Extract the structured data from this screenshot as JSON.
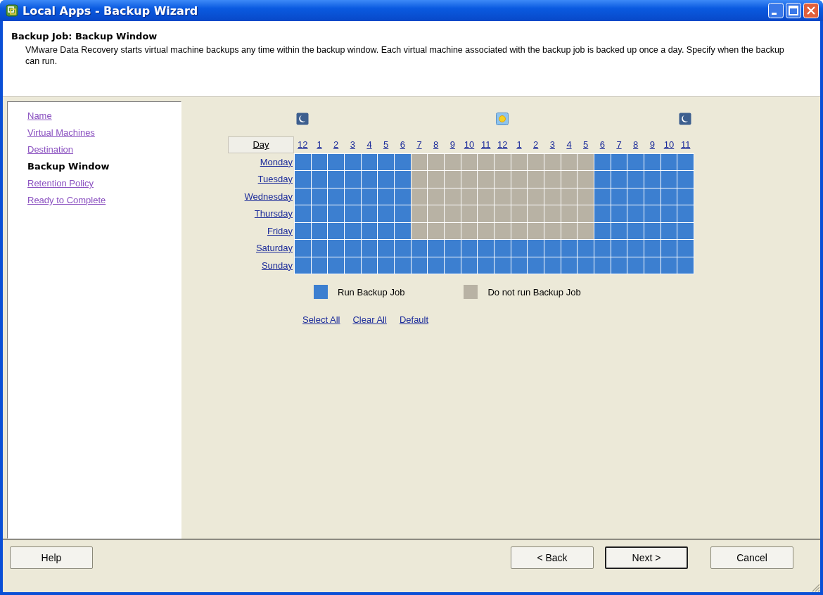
{
  "window": {
    "title": "Local Apps - Backup Wizard"
  },
  "header": {
    "title": "Backup Job: Backup Window",
    "description": "VMware Data Recovery starts virtual machine backups any time within the backup window.  Each virtual machine associated with the backup job is backed up once a day.  Specify when the backup can run."
  },
  "steps": [
    {
      "label": "Name",
      "selected": false
    },
    {
      "label": "Virtual Machines",
      "selected": false
    },
    {
      "label": "Destination",
      "selected": false
    },
    {
      "label": "Backup Window",
      "selected": true
    },
    {
      "label": "Retention Policy",
      "selected": false
    },
    {
      "label": "Ready to Complete",
      "selected": false
    }
  ],
  "schedule": {
    "day_heading": "Day",
    "hours": [
      "12",
      "1",
      "2",
      "3",
      "4",
      "5",
      "6",
      "7",
      "8",
      "9",
      "10",
      "11",
      "12",
      "1",
      "2",
      "3",
      "4",
      "5",
      "6",
      "7",
      "8",
      "9",
      "10",
      "11"
    ],
    "days": [
      {
        "label": "Monday",
        "slots": [
          true,
          true,
          true,
          true,
          true,
          true,
          true,
          false,
          false,
          false,
          false,
          false,
          false,
          false,
          false,
          false,
          false,
          false,
          true,
          true,
          true,
          true,
          true,
          true
        ]
      },
      {
        "label": "Tuesday",
        "slots": [
          true,
          true,
          true,
          true,
          true,
          true,
          true,
          false,
          false,
          false,
          false,
          false,
          false,
          false,
          false,
          false,
          false,
          false,
          true,
          true,
          true,
          true,
          true,
          true
        ]
      },
      {
        "label": "Wednesday",
        "slots": [
          true,
          true,
          true,
          true,
          true,
          true,
          true,
          false,
          false,
          false,
          false,
          false,
          false,
          false,
          false,
          false,
          false,
          false,
          true,
          true,
          true,
          true,
          true,
          true
        ]
      },
      {
        "label": "Thursday",
        "slots": [
          true,
          true,
          true,
          true,
          true,
          true,
          true,
          false,
          false,
          false,
          false,
          false,
          false,
          false,
          false,
          false,
          false,
          false,
          true,
          true,
          true,
          true,
          true,
          true
        ]
      },
      {
        "label": "Friday",
        "slots": [
          true,
          true,
          true,
          true,
          true,
          true,
          true,
          false,
          false,
          false,
          false,
          false,
          false,
          false,
          false,
          false,
          false,
          false,
          true,
          true,
          true,
          true,
          true,
          true
        ]
      },
      {
        "label": "Saturday",
        "slots": [
          true,
          true,
          true,
          true,
          true,
          true,
          true,
          true,
          true,
          true,
          true,
          true,
          true,
          true,
          true,
          true,
          true,
          true,
          true,
          true,
          true,
          true,
          true,
          true
        ]
      },
      {
        "label": "Sunday",
        "slots": [
          true,
          true,
          true,
          true,
          true,
          true,
          true,
          true,
          true,
          true,
          true,
          true,
          true,
          true,
          true,
          true,
          true,
          true,
          true,
          true,
          true,
          true,
          true,
          true
        ]
      }
    ],
    "legend": [
      {
        "kind": "run",
        "label": "Run Backup Job"
      },
      {
        "kind": "skip",
        "label": "Do not run Backup Job"
      }
    ],
    "actions": [
      "Select All",
      "Clear All",
      "Default"
    ]
  },
  "buttons": {
    "help": "Help",
    "back": "< Back",
    "next": "Next >",
    "cancel": "Cancel"
  }
}
